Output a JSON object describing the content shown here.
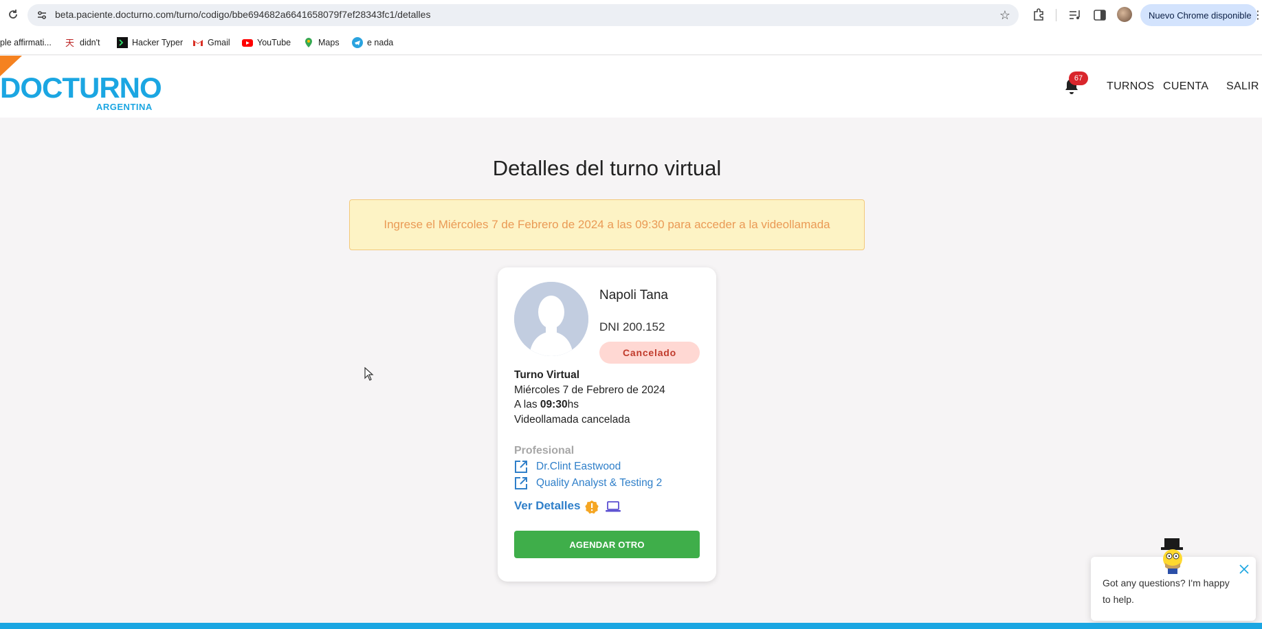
{
  "browser": {
    "url": "beta.paciente.docturno.com/turno/codigo/bbe694682a6641658079f7ef28343fc1/detalles",
    "update_label": "Nuevo Chrome disponible",
    "bookmarks": [
      {
        "label": "ple affirmati...",
        "icon": "none"
      },
      {
        "label": "didn't",
        "icon": "kanji-icon"
      },
      {
        "label": "Hacker Typer",
        "icon": "terminal-icon"
      },
      {
        "label": "Gmail",
        "icon": "gmail-icon"
      },
      {
        "label": "YouTube",
        "icon": "youtube-icon"
      },
      {
        "label": "Maps",
        "icon": "maps-icon"
      },
      {
        "label": "e nada",
        "icon": "telegram-icon"
      }
    ]
  },
  "header": {
    "logo_main": "DOCTURNO",
    "logo_sub": "ARGENTINA",
    "notifications_count": "67",
    "nav": {
      "turnos": "TURNOS",
      "cuenta": "CUENTA",
      "salir": "SALIR"
    }
  },
  "main": {
    "title": "Detalles del turno virtual",
    "alert": "Ingrese el Miércoles 7 de Febrero de 2024 a las 09:30 para acceder a la videollamada"
  },
  "card": {
    "patient_name": "Napoli Tana",
    "dni": "DNI 200.152",
    "status": "Cancelado",
    "type": "Turno Virtual",
    "date": "Miércoles 7 de Febrero de 2024",
    "time_prefix": "A las ",
    "time": "09:30",
    "time_suffix": "hs",
    "call_status": "Videollamada cancelada",
    "professional_label": "Profesional",
    "doctor": "Dr.Clint Eastwood",
    "specialty": "Quality Analyst & Testing 2",
    "details_link": "Ver Detalles",
    "cta": "AGENDAR OTRO"
  },
  "chat": {
    "message": "Got any questions? I'm happy to help."
  },
  "colors": {
    "brand": "#1ba6e2",
    "accent": "#f58220",
    "cta": "#3fae4a",
    "danger": "#d9262c"
  }
}
